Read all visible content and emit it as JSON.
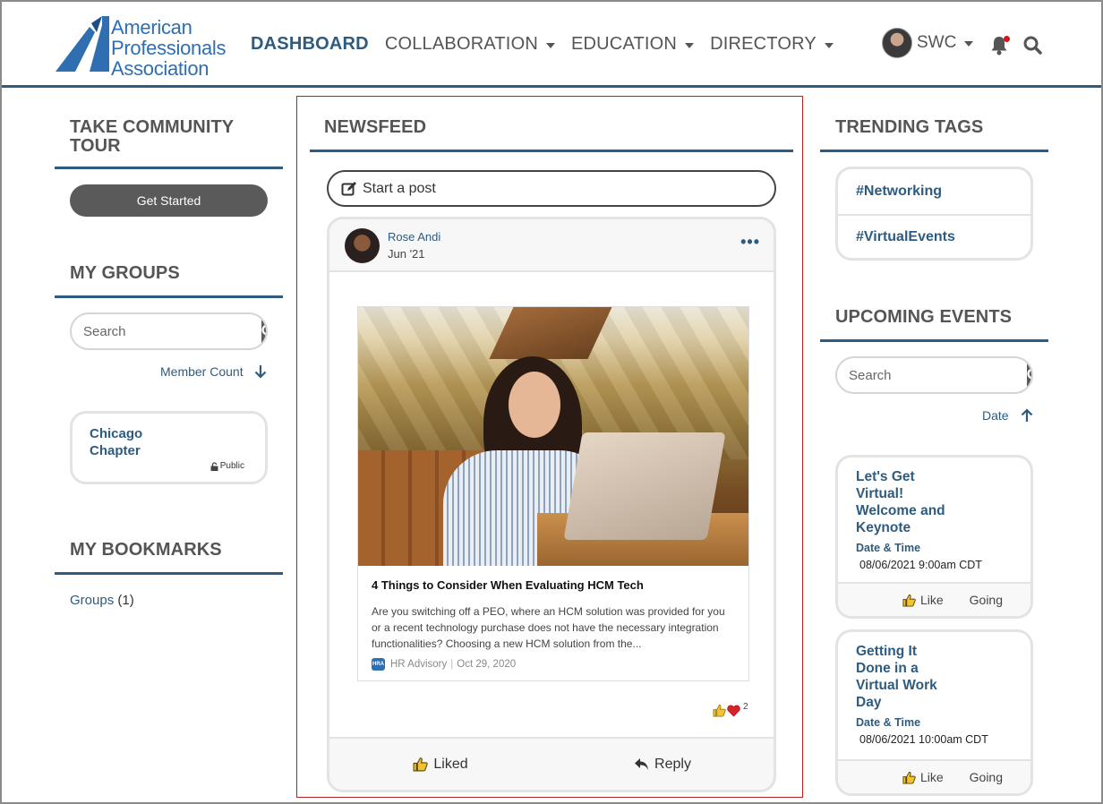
{
  "header": {
    "logo_lines": [
      "American",
      "Professionals",
      "Association"
    ],
    "nav": [
      {
        "label": "DASHBOARD"
      },
      {
        "label": "COLLABORATION"
      },
      {
        "label": "EDUCATION"
      },
      {
        "label": "DIRECTORY"
      }
    ],
    "user_label": "SWC"
  },
  "left": {
    "tour_title_line1": "TAKE COMMUNITY",
    "tour_title_line2": "TOUR",
    "get_started": "Get Started",
    "groups_title": "MY GROUPS",
    "groups_search_placeholder": "Search",
    "groups_sort": "Member Count",
    "group_card": {
      "name_line1": "Chicago",
      "name_line2": "Chapter",
      "privacy": "Public"
    },
    "bookmarks_title": "MY BOOKMARKS",
    "bookmark_link": "Groups",
    "bookmark_count": "(1)"
  },
  "newsfeed": {
    "title": "NEWSFEED",
    "start_post": "Start a post",
    "post": {
      "author": "Rose Andi",
      "date": "Jun '21",
      "more": "•••",
      "link_title": "4 Things to Consider When Evaluating HCM Tech",
      "link_desc": "Are you switching off a PEO, where an HCM solution was provided for you or a recent technology purchase does not have the necessary integration functionalities? Choosing a new HCM solution from the...",
      "source_icon": "HRA",
      "source_name": "HR Advisory",
      "source_sep": "|",
      "source_date": "Oct 29, 2020",
      "reaction_count": "2",
      "liked_label": "Liked",
      "reply_label": "Reply"
    }
  },
  "right": {
    "tags_title": "TRENDING TAGS",
    "tags": [
      "#Networking",
      "#VirtualEvents"
    ],
    "events_title": "UPCOMING EVENTS",
    "events_search_placeholder": "Search",
    "events_sort": "Date",
    "events": [
      {
        "title_lines": [
          "Let's Get",
          "Virtual!",
          "Welcome and",
          "Keynote"
        ],
        "dt_label": "Date & Time",
        "dt": "08/06/2021 9:00am CDT",
        "like": "Like",
        "going": "Going"
      },
      {
        "title_lines": [
          "Getting It",
          "Done in a",
          "Virtual Work",
          "Day"
        ],
        "dt_label": "Date & Time",
        "dt": "08/06/2021 10:00am CDT",
        "like": "Like",
        "going": "Going"
      }
    ]
  },
  "colors": {
    "primary": "#2e5b80",
    "logo_blue": "#2f6eb0",
    "dark_button": "#5a5a5a",
    "highlight_border": "#b32525",
    "notification_dot": "#dd1111"
  },
  "icons": [
    "search-icon",
    "bell-icon",
    "edit-icon",
    "thumbs-up-icon",
    "heart-icon",
    "reply-icon",
    "lock-icon",
    "arrow-down-icon",
    "arrow-up-icon",
    "chevron-down-icon"
  ]
}
